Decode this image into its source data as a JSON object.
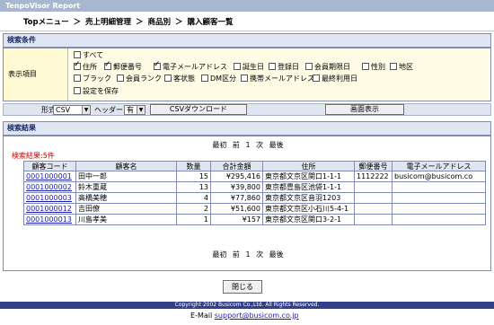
{
  "app": {
    "title": "TenpoVisor  Report"
  },
  "breadcrumb": {
    "items": [
      "Topメニュー",
      "売上明細管理",
      "商品別",
      "購入顧客一覧"
    ],
    "sep": "＞"
  },
  "conditions": {
    "section_title": "検索条件",
    "label": "表示項目",
    "options": [
      {
        "label": "すべて",
        "checked": false
      },
      {
        "label": "住所",
        "checked": true
      },
      {
        "label": "郵便番号",
        "checked": true
      },
      {
        "label": "電子メールアドレス",
        "checked": true
      },
      {
        "label": "誕生日",
        "checked": false
      },
      {
        "label": "登録日",
        "checked": false
      },
      {
        "label": "会員期限日",
        "checked": false
      },
      {
        "label": "性別",
        "checked": false
      },
      {
        "label": "地区",
        "checked": false
      },
      {
        "label": "ブラック",
        "checked": false
      },
      {
        "label": "会員ランク",
        "checked": false
      },
      {
        "label": "客状態",
        "checked": false
      },
      {
        "label": "DM区分",
        "checked": false
      },
      {
        "label": "携帯メールアドレス",
        "checked": false
      },
      {
        "label": "最終利用日",
        "checked": false
      },
      {
        "label": "設定を保存",
        "checked": false
      }
    ]
  },
  "toolbar": {
    "format_label": "形式",
    "format_value": "CSV",
    "header_label": "ヘッダー",
    "header_value": "有",
    "csv_button": "CSVダウンロード",
    "display_button": "画面表示"
  },
  "results": {
    "section_title": "検索結果",
    "count_text": "検索結果:5件",
    "pager": {
      "first": "最初",
      "prev": "前",
      "page": "1",
      "next": "次",
      "last": "最後"
    },
    "columns": [
      "顧客コード",
      "顧客名",
      "数量",
      "合計金額",
      "住所",
      "郵便番号",
      "電子メールアドレス"
    ],
    "rows": [
      {
        "code": "0001000001",
        "name": "田中一郎",
        "qty": "15",
        "total": "¥295,416",
        "address": "東京都文京区関口1-1-1",
        "zip": "1112222",
        "email": "busicom@busicom.co"
      },
      {
        "code": "0001000002",
        "name": "鈴木重蔵",
        "qty": "13",
        "total": "¥39,800",
        "address": "東京都豊島区池袋1-1-1",
        "zip": "",
        "email": ""
      },
      {
        "code": "0001000003",
        "name": "高橋美穂",
        "qty": "4",
        "total": "¥77,860",
        "address": "東京都文京区音羽1203",
        "zip": "",
        "email": ""
      },
      {
        "code": "0001000012",
        "name": "吉田僚",
        "qty": "2",
        "total": "¥51,600",
        "address": "東京都文京区小石川5-4-1",
        "zip": "",
        "email": ""
      },
      {
        "code": "0001000013",
        "name": "川島孝美",
        "qty": "1",
        "total": "¥157",
        "address": "東京都文京区関口3-2-1",
        "zip": "",
        "email": ""
      }
    ]
  },
  "close_button": "閉じる",
  "footer": {
    "copyright": "Copyright 2002 Busicom Co.,Ltd. All Rights Reserved.",
    "mail_label": "E-Mail",
    "mail_address": "support@busicom.co.jp"
  }
}
